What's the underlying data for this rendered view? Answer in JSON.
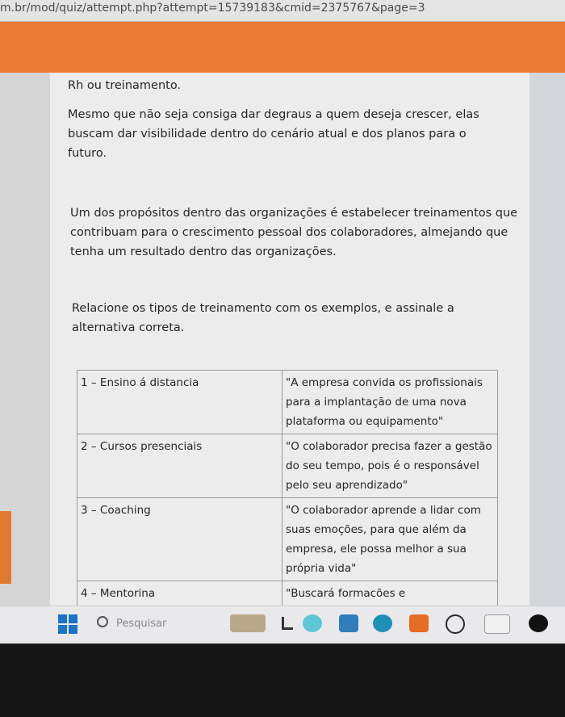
{
  "browser": {
    "url": "m.br/mod/quiz/attempt.php?attempt=15739183&cmid=2375767&page=3"
  },
  "question": {
    "paragraph_0": "Rh ou treinamento.",
    "paragraph_1": "Mesmo que não seja consiga dar degraus a quem deseja crescer, elas buscam dar visibilidade dentro do cenário atual e dos planos para o futuro.",
    "paragraph_2": "Um dos propósitos dentro das organizações é estabelecer treinamentos que contribuam para o crescimento pessoal dos colaboradores, almejando que tenha um resultado dentro das organizações.",
    "paragraph_3": "Relacione os tipos de treinamento com os exemplos, e assinale a alternativa correta.",
    "table": [
      {
        "left": "1 – Ensino á distancia",
        "right": "\"A empresa convida os profissionais para a implantação de uma nova plataforma ou equipamento\""
      },
      {
        "left": "2 – Cursos presenciais",
        "right": "\"O colaborador precisa fazer a gestão do seu tempo, pois é o responsável pelo seu aprendizado\""
      },
      {
        "left": "3 – Coaching",
        "right": "\"O colaborador aprende a lidar com suas emoções, para que além da empresa, ele possa melhor a sua própria vida\""
      },
      {
        "left": "4 – Mentorina",
        "right": "\"Buscará formacões e"
      }
    ]
  },
  "taskbar": {
    "search_placeholder": "Pesquisar",
    "colors": {
      "windows": "#1a73c8",
      "accent_orange": "#e97b34"
    }
  }
}
